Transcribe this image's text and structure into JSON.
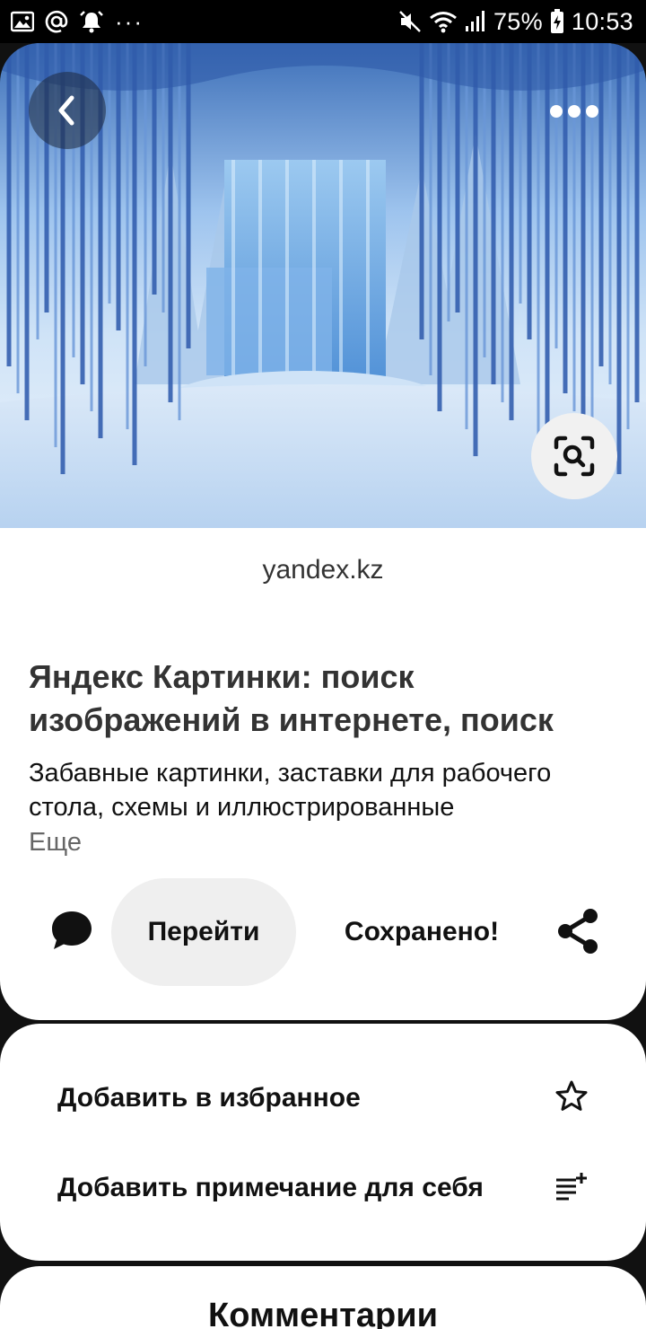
{
  "status_bar": {
    "battery": "75%",
    "time": "10:53",
    "more_indicator": "···"
  },
  "hero": {
    "back_icon": "chevron-left-icon",
    "more_icon": "more-horizontal-icon",
    "lens_icon": "visual-search-icon"
  },
  "pin": {
    "domain": "yandex.kz",
    "title": "Яндекс Картинки: поиск изображений в интернете, поиск",
    "description": "Забавные картинки, заставки для рабочего стола, схемы и иллюстрированные",
    "more_label": "Еще",
    "go_label": "Перейти",
    "saved_label": "Сохранено!"
  },
  "menu": {
    "items": [
      {
        "label": "Добавить в избранное",
        "icon": "star-icon"
      },
      {
        "label": "Добавить примечание для себя",
        "icon": "add-note-icon"
      }
    ]
  },
  "comments": {
    "title": "Комментарии"
  }
}
